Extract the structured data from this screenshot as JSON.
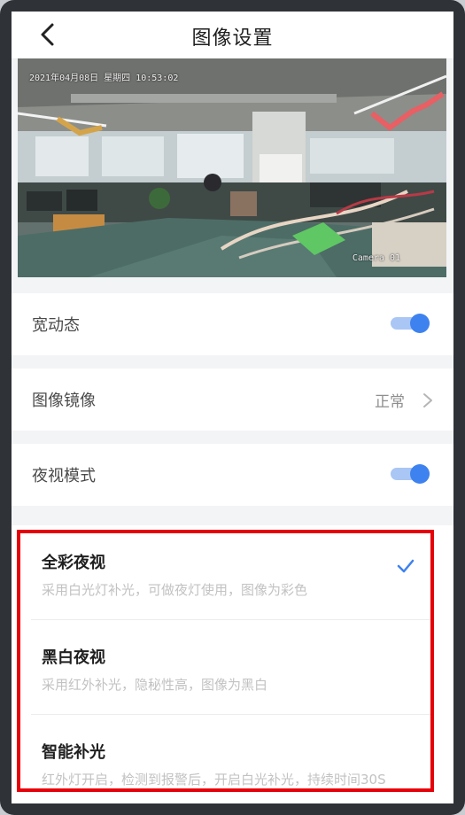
{
  "header": {
    "title": "图像设置"
  },
  "preview": {
    "timestamp": "2021年04月08日  星期四  10:53:02",
    "camera_label": "Camera 01"
  },
  "settings": {
    "wdr": {
      "label": "宽动态",
      "enabled": true
    },
    "mirror": {
      "label": "图像镜像",
      "value": "正常"
    },
    "night_vision": {
      "label": "夜视模式",
      "enabled": true
    }
  },
  "modes": [
    {
      "title": "全彩夜视",
      "desc": "采用白光灯补光，可做夜灯使用，图像为彩色",
      "selected": true
    },
    {
      "title": "黑白夜视",
      "desc": "采用红外补光，隐秘性高，图像为黑白",
      "selected": false
    },
    {
      "title": "智能补光",
      "desc": "红外灯开启，检测到报警后，开启白光补光，持续时间30S",
      "selected": false
    }
  ],
  "colors": {
    "accent": "#3e82ef",
    "highlight": "#e6000a"
  },
  "icons": {
    "back": "chevron-left-icon",
    "forward": "chevron-right-icon",
    "selected": "checkmark-icon"
  }
}
